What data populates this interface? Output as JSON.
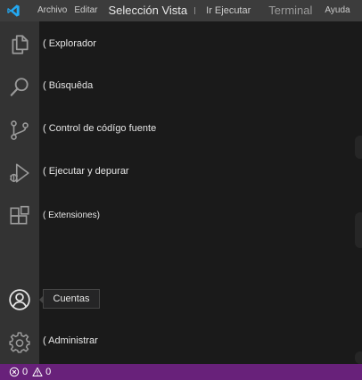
{
  "menubar": {
    "items": [
      {
        "id": "archivo",
        "label": "Archivo"
      },
      {
        "id": "editar",
        "label": "Editar"
      },
      {
        "id": "seleccion-vista",
        "label": "Selección Vista"
      },
      {
        "id": "ir-ejecutar",
        "label": "Ir Ejecutar"
      },
      {
        "id": "terminal",
        "label": "Terminal"
      },
      {
        "id": "ayuda",
        "label": "Ayuda"
      }
    ]
  },
  "activity": {
    "items": [
      {
        "id": "explorer",
        "icon": "files-icon",
        "label": "( Explorador"
      },
      {
        "id": "search",
        "icon": "search-icon",
        "label": "( Búsquêda"
      },
      {
        "id": "scm",
        "icon": "source-control-icon",
        "label": "( Control de códígo fuente"
      },
      {
        "id": "debug",
        "icon": "run-debug-icon",
        "label": "( Ejecutar y depurar"
      },
      {
        "id": "extensions",
        "icon": "extensions-icon",
        "label": "( Extensiones)"
      },
      {
        "id": "accounts",
        "icon": "account-icon",
        "label": "Cuentas"
      },
      {
        "id": "manage",
        "icon": "gear-icon",
        "label": "( Administrar"
      }
    ]
  },
  "statusbar": {
    "errors": "0",
    "warnings": "0",
    "color": "#68217a"
  },
  "colors": {
    "menubar": "#3c3c3c",
    "activitybar": "#333333",
    "logo": "#23a9f2"
  }
}
